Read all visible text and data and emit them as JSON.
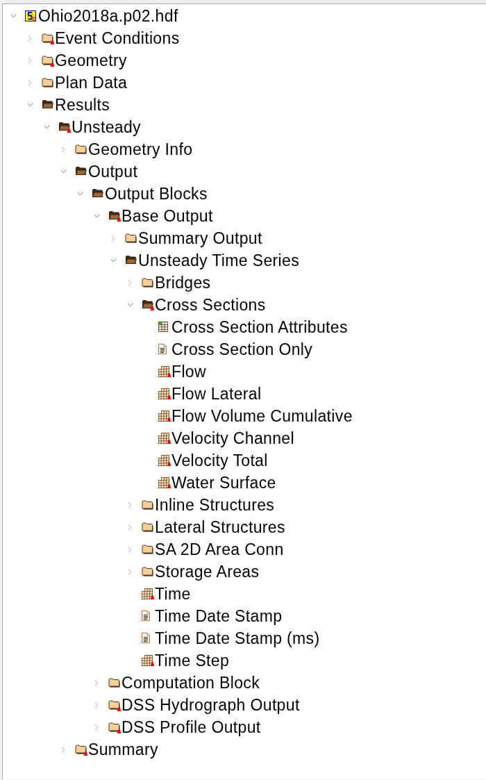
{
  "tree": [
    {
      "label": "Ohio2018a.p02.hdf",
      "kind": "file",
      "expanded": true,
      "attributes": false,
      "children": [
        {
          "label": "Event Conditions",
          "kind": "group",
          "expanded": false,
          "attributes": true
        },
        {
          "label": "Geometry",
          "kind": "group",
          "expanded": false,
          "attributes": true
        },
        {
          "label": "Plan Data",
          "kind": "group",
          "expanded": false,
          "attributes": false
        },
        {
          "label": "Results",
          "kind": "group",
          "expanded": true,
          "attributes": false,
          "children": [
            {
              "label": "Unsteady",
              "kind": "group",
              "expanded": true,
              "attributes": true,
              "children": [
                {
                  "label": "Geometry Info",
                  "kind": "group",
                  "expanded": false,
                  "attributes": false
                },
                {
                  "label": "Output",
                  "kind": "group",
                  "expanded": true,
                  "attributes": false,
                  "children": [
                    {
                      "label": "Output Blocks",
                      "kind": "group",
                      "expanded": true,
                      "attributes": false,
                      "children": [
                        {
                          "label": "Base Output",
                          "kind": "group",
                          "expanded": true,
                          "attributes": true,
                          "children": [
                            {
                              "label": "Summary Output",
                              "kind": "group",
                              "expanded": false,
                              "attributes": false
                            },
                            {
                              "label": "Unsteady Time Series",
                              "kind": "group",
                              "expanded": true,
                              "attributes": false,
                              "children": [
                                {
                                  "label": "Bridges",
                                  "kind": "group",
                                  "expanded": false,
                                  "attributes": false
                                },
                                {
                                  "label": "Cross Sections",
                                  "kind": "group",
                                  "expanded": true,
                                  "attributes": true,
                                  "children": [
                                    {
                                      "label": "Cross Section Attributes",
                                      "kind": "table",
                                      "attributes": false
                                    },
                                    {
                                      "label": "Cross Section Only",
                                      "kind": "text",
                                      "attributes": false
                                    },
                                    {
                                      "label": "Flow",
                                      "kind": "dataset",
                                      "attributes": true
                                    },
                                    {
                                      "label": "Flow Lateral",
                                      "kind": "dataset",
                                      "attributes": true
                                    },
                                    {
                                      "label": "Flow Volume Cumulative",
                                      "kind": "dataset",
                                      "attributes": true
                                    },
                                    {
                                      "label": "Velocity Channel",
                                      "kind": "dataset",
                                      "attributes": true
                                    },
                                    {
                                      "label": "Velocity Total",
                                      "kind": "dataset",
                                      "attributes": true
                                    },
                                    {
                                      "label": "Water Surface",
                                      "kind": "dataset",
                                      "attributes": true
                                    }
                                  ]
                                },
                                {
                                  "label": "Inline Structures",
                                  "kind": "group",
                                  "expanded": false,
                                  "attributes": false
                                },
                                {
                                  "label": "Lateral Structures",
                                  "kind": "group",
                                  "expanded": false,
                                  "attributes": false
                                },
                                {
                                  "label": "SA 2D Area Conn",
                                  "kind": "group",
                                  "expanded": false,
                                  "attributes": false
                                },
                                {
                                  "label": "Storage Areas",
                                  "kind": "group",
                                  "expanded": false,
                                  "attributes": false
                                },
                                {
                                  "label": "Time",
                                  "kind": "dataset",
                                  "attributes": true
                                },
                                {
                                  "label": "Time Date Stamp",
                                  "kind": "text",
                                  "attributes": false
                                },
                                {
                                  "label": "Time Date Stamp (ms)",
                                  "kind": "text",
                                  "attributes": false
                                },
                                {
                                  "label": "Time Step",
                                  "kind": "dataset",
                                  "attributes": true
                                }
                              ]
                            }
                          ]
                        },
                        {
                          "label": "Computation Block",
                          "kind": "group",
                          "expanded": false,
                          "attributes": false
                        },
                        {
                          "label": "DSS Hydrograph Output",
                          "kind": "group",
                          "expanded": false,
                          "attributes": true
                        },
                        {
                          "label": "DSS Profile Output",
                          "kind": "group",
                          "expanded": false,
                          "attributes": true
                        }
                      ]
                    }
                  ]
                },
                {
                  "label": "Summary",
                  "kind": "group",
                  "expanded": false,
                  "attributes": true
                }
              ]
            }
          ]
        }
      ]
    }
  ]
}
